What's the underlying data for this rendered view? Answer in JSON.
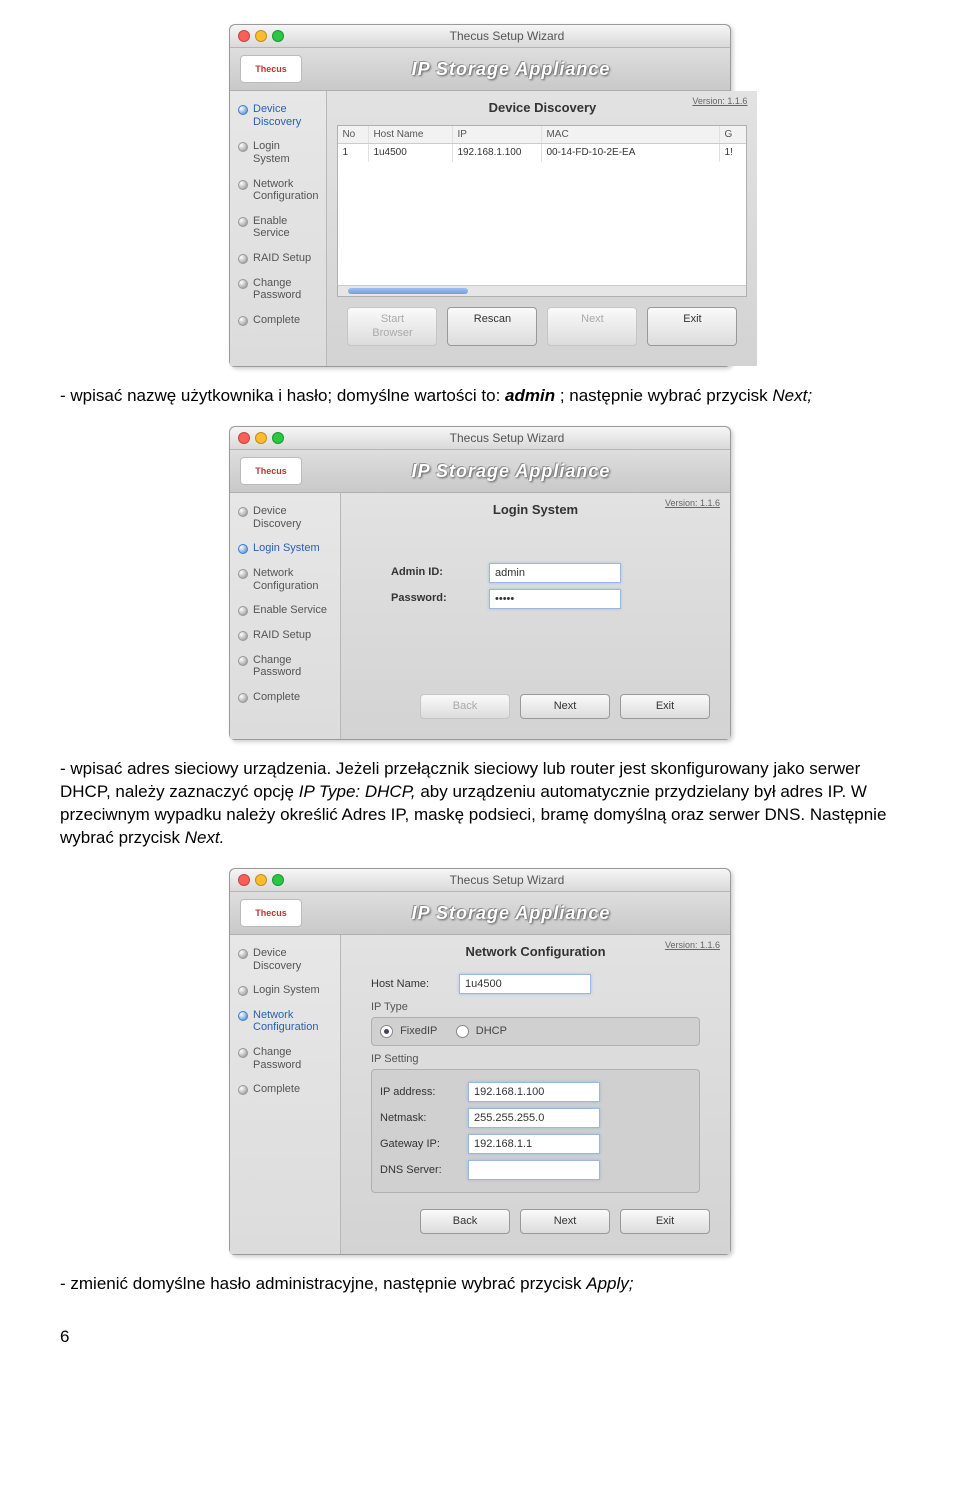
{
  "doc": {
    "text1_pre": "- wpisać nazwę użytkownika i hasło; domyślne wartości to: ",
    "text1_admin": "admin",
    "text1_mid": "; następnie wybrać przycisk ",
    "text1_next": "Next;",
    "text2": "- wpisać adres sieciowy urządzenia. Jeżeli przełącznik sieciowy lub router jest skonfigurowany jako serwer DHCP, należy zaznaczyć opcję ",
    "text2_ip": "IP Type: DHCP,",
    "text2_b": " aby urządzeniu automatycznie przydzielany był adres IP. W przeciwnym wypadku należy określić Adres IP, maskę podsieci, bramę domyślną oraz serwer DNS. Następnie wybrać przycisk ",
    "text2_next": "Next.",
    "text3_pre": "- zmienić domyślne hasło administracyjne, następnie wybrać przycisk ",
    "text3_apply": "Apply;",
    "page_num": "6"
  },
  "common": {
    "window_title": "Thecus Setup Wizard",
    "appliance": "IP Storage Appliance",
    "logo": "Thecus",
    "version": "Version: 1.1.6"
  },
  "sidebar_full": [
    "Device Discovery",
    "Login System",
    "Network Configuration",
    "Enable Service",
    "RAID Setup",
    "Change Password",
    "Complete"
  ],
  "sidebar_short": [
    "Device Discovery",
    "Login System",
    "Network Configuration",
    "Change Password",
    "Complete"
  ],
  "screen1": {
    "title": "Device Discovery",
    "cols": {
      "no": "No",
      "host": "Host Name",
      "ip": "IP",
      "mac": "MAC",
      "g": "G"
    },
    "row": {
      "no": "1",
      "host": "1u4500",
      "ip": "192.168.1.100",
      "mac": "00-14-FD-10-2E-EA",
      "g": "1!"
    },
    "btn_start": "Start Browser",
    "btn_rescan": "Rescan",
    "btn_next": "Next",
    "btn_exit": "Exit"
  },
  "screen2": {
    "title": "Login System",
    "admin_label": "Admin ID:",
    "admin_val": "admin",
    "pw_label": "Password:",
    "pw_val": "•••••",
    "btn_back": "Back",
    "btn_next": "Next",
    "btn_exit": "Exit"
  },
  "screen3": {
    "title": "Network Configuration",
    "hostname_label": "Host Name:",
    "hostname_val": "1u4500",
    "iptype_label": "IP Type",
    "fixed": "FixedIP",
    "dhcp": "DHCP",
    "ipsetting_label": "IP Setting",
    "ipaddr_label": "IP address:",
    "ipaddr_val": "192.168.1.100",
    "netmask_label": "Netmask:",
    "netmask_val": "255.255.255.0",
    "gateway_label": "Gateway IP:",
    "gateway_val": "192.168.1.1",
    "dns_label": "DNS Server:",
    "dns_val": "",
    "btn_back": "Back",
    "btn_next": "Next",
    "btn_exit": "Exit"
  }
}
